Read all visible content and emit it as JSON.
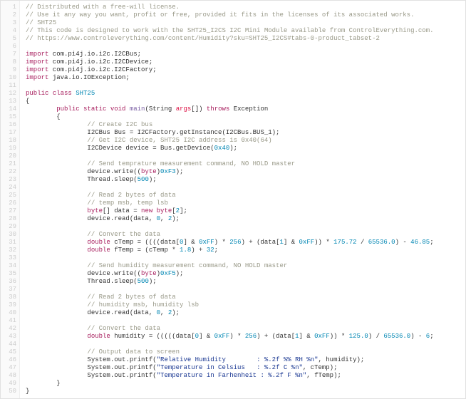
{
  "lines": [
    {
      "num": "1",
      "parts": [
        {
          "cls": "c",
          "t": "// Distributed with a free-will license."
        }
      ]
    },
    {
      "num": "2",
      "parts": [
        {
          "cls": "c",
          "t": "// Use it any way you want, profit or free, provided it fits in the licenses of its associated works."
        }
      ]
    },
    {
      "num": "3",
      "parts": [
        {
          "cls": "c",
          "t": "// SHT25"
        }
      ]
    },
    {
      "num": "4",
      "parts": [
        {
          "cls": "c",
          "t": "// This code is designed to work with the SHT25_I2CS I2C Mini Module available from ControlEverything.com."
        }
      ]
    },
    {
      "num": "5",
      "parts": [
        {
          "cls": "c",
          "t": "// https://www.controleverything.com/content/Humidity?sku=SHT25_I2CS#tabs-0-product_tabset-2"
        }
      ]
    },
    {
      "num": "6",
      "parts": []
    },
    {
      "num": "7",
      "parts": [
        {
          "cls": "kw",
          "t": "import"
        },
        {
          "cls": "id",
          "t": " com.pi4j.io.i2c.I2CBus;"
        }
      ]
    },
    {
      "num": "8",
      "parts": [
        {
          "cls": "kw",
          "t": "import"
        },
        {
          "cls": "id",
          "t": " com.pi4j.io.i2c.I2CDevice;"
        }
      ]
    },
    {
      "num": "9",
      "parts": [
        {
          "cls": "kw",
          "t": "import"
        },
        {
          "cls": "id",
          "t": " com.pi4j.io.i2c.I2CFactory;"
        }
      ]
    },
    {
      "num": "10",
      "parts": [
        {
          "cls": "kw",
          "t": "import"
        },
        {
          "cls": "id",
          "t": " java.io.IOException;"
        }
      ]
    },
    {
      "num": "11",
      "parts": []
    },
    {
      "num": "12",
      "parts": [
        {
          "cls": "kw",
          "t": "public"
        },
        {
          "cls": "id",
          "t": " "
        },
        {
          "cls": "kw",
          "t": "class"
        },
        {
          "cls": "id",
          "t": " "
        },
        {
          "cls": "ty",
          "t": "SHT25"
        }
      ]
    },
    {
      "num": "13",
      "parts": [
        {
          "cls": "id",
          "t": "{"
        }
      ]
    },
    {
      "num": "14",
      "parts": [
        {
          "cls": "id",
          "t": "        "
        },
        {
          "cls": "kw",
          "t": "public"
        },
        {
          "cls": "id",
          "t": " "
        },
        {
          "cls": "kw",
          "t": "static"
        },
        {
          "cls": "id",
          "t": " "
        },
        {
          "cls": "kw",
          "t": "void"
        },
        {
          "cls": "id",
          "t": " "
        },
        {
          "cls": "fn",
          "t": "main"
        },
        {
          "cls": "id",
          "t": "(String "
        },
        {
          "cls": "ar",
          "t": "args"
        },
        {
          "cls": "id",
          "t": "[]) "
        },
        {
          "cls": "kw",
          "t": "throws"
        },
        {
          "cls": "id",
          "t": " Exception"
        }
      ]
    },
    {
      "num": "15",
      "parts": [
        {
          "cls": "id",
          "t": "        {"
        }
      ]
    },
    {
      "num": "16",
      "parts": [
        {
          "cls": "id",
          "t": "                "
        },
        {
          "cls": "c",
          "t": "// Create I2C bus"
        }
      ]
    },
    {
      "num": "17",
      "parts": [
        {
          "cls": "id",
          "t": "                I2CBus Bus = I2CFactory.getInstance(I2CBus.BUS_1);"
        }
      ]
    },
    {
      "num": "18",
      "parts": [
        {
          "cls": "id",
          "t": "                "
        },
        {
          "cls": "c",
          "t": "// Get I2C device, SHT25 I2C address is 0x40(64)"
        }
      ]
    },
    {
      "num": "19",
      "parts": [
        {
          "cls": "id",
          "t": "                I2CDevice device = Bus.getDevice("
        },
        {
          "cls": "nu",
          "t": "0x40"
        },
        {
          "cls": "id",
          "t": ");"
        }
      ]
    },
    {
      "num": "20",
      "parts": []
    },
    {
      "num": "21",
      "parts": [
        {
          "cls": "id",
          "t": "                "
        },
        {
          "cls": "c",
          "t": "// Send temprature measurement command, NO HOLD master"
        }
      ]
    },
    {
      "num": "22",
      "parts": [
        {
          "cls": "id",
          "t": "                device.write(("
        },
        {
          "cls": "kw",
          "t": "byte"
        },
        {
          "cls": "id",
          "t": ")"
        },
        {
          "cls": "nu",
          "t": "0xF3"
        },
        {
          "cls": "id",
          "t": ");"
        }
      ]
    },
    {
      "num": "23",
      "parts": [
        {
          "cls": "id",
          "t": "                Thread.sleep("
        },
        {
          "cls": "nu",
          "t": "500"
        },
        {
          "cls": "id",
          "t": ");"
        }
      ]
    },
    {
      "num": "24",
      "parts": []
    },
    {
      "num": "25",
      "parts": [
        {
          "cls": "id",
          "t": "                "
        },
        {
          "cls": "c",
          "t": "// Read 2 bytes of data"
        }
      ]
    },
    {
      "num": "26",
      "parts": [
        {
          "cls": "id",
          "t": "                "
        },
        {
          "cls": "c",
          "t": "// temp msb, temp lsb"
        }
      ]
    },
    {
      "num": "27",
      "parts": [
        {
          "cls": "id",
          "t": "                "
        },
        {
          "cls": "kw",
          "t": "byte"
        },
        {
          "cls": "id",
          "t": "[] data = "
        },
        {
          "cls": "kw",
          "t": "new"
        },
        {
          "cls": "id",
          "t": " "
        },
        {
          "cls": "kw",
          "t": "byte"
        },
        {
          "cls": "id",
          "t": "["
        },
        {
          "cls": "nu",
          "t": "2"
        },
        {
          "cls": "id",
          "t": "];"
        }
      ]
    },
    {
      "num": "28",
      "parts": [
        {
          "cls": "id",
          "t": "                device.read(data, "
        },
        {
          "cls": "nu",
          "t": "0"
        },
        {
          "cls": "id",
          "t": ", "
        },
        {
          "cls": "nu",
          "t": "2"
        },
        {
          "cls": "id",
          "t": ");"
        }
      ]
    },
    {
      "num": "29",
      "parts": []
    },
    {
      "num": "30",
      "parts": [
        {
          "cls": "id",
          "t": "                "
        },
        {
          "cls": "c",
          "t": "// Convert the data"
        }
      ]
    },
    {
      "num": "31",
      "parts": [
        {
          "cls": "id",
          "t": "                "
        },
        {
          "cls": "kw",
          "t": "double"
        },
        {
          "cls": "id",
          "t": " cTemp = ((((data["
        },
        {
          "cls": "nu",
          "t": "0"
        },
        {
          "cls": "id",
          "t": "] & "
        },
        {
          "cls": "nu",
          "t": "0xFF"
        },
        {
          "cls": "id",
          "t": ") * "
        },
        {
          "cls": "nu",
          "t": "256"
        },
        {
          "cls": "id",
          "t": ") + (data["
        },
        {
          "cls": "nu",
          "t": "1"
        },
        {
          "cls": "id",
          "t": "] & "
        },
        {
          "cls": "nu",
          "t": "0xFF"
        },
        {
          "cls": "id",
          "t": ")) * "
        },
        {
          "cls": "nu",
          "t": "175.72"
        },
        {
          "cls": "id",
          "t": " / "
        },
        {
          "cls": "nu",
          "t": "65536.0"
        },
        {
          "cls": "id",
          "t": ") - "
        },
        {
          "cls": "nu",
          "t": "46.85"
        },
        {
          "cls": "id",
          "t": ";"
        }
      ]
    },
    {
      "num": "32",
      "parts": [
        {
          "cls": "id",
          "t": "                "
        },
        {
          "cls": "kw",
          "t": "double"
        },
        {
          "cls": "id",
          "t": " fTemp = (cTemp * "
        },
        {
          "cls": "nu",
          "t": "1.8"
        },
        {
          "cls": "id",
          "t": ") + "
        },
        {
          "cls": "nu",
          "t": "32"
        },
        {
          "cls": "id",
          "t": ";"
        }
      ]
    },
    {
      "num": "33",
      "parts": []
    },
    {
      "num": "34",
      "parts": [
        {
          "cls": "id",
          "t": "                "
        },
        {
          "cls": "c",
          "t": "// Send humidity measurement command, NO HOLD master"
        }
      ]
    },
    {
      "num": "35",
      "parts": [
        {
          "cls": "id",
          "t": "                device.write(("
        },
        {
          "cls": "kw",
          "t": "byte"
        },
        {
          "cls": "id",
          "t": ")"
        },
        {
          "cls": "nu",
          "t": "0xF5"
        },
        {
          "cls": "id",
          "t": ");"
        }
      ]
    },
    {
      "num": "36",
      "parts": [
        {
          "cls": "id",
          "t": "                Thread.sleep("
        },
        {
          "cls": "nu",
          "t": "500"
        },
        {
          "cls": "id",
          "t": ");"
        }
      ]
    },
    {
      "num": "37",
      "parts": []
    },
    {
      "num": "38",
      "parts": [
        {
          "cls": "id",
          "t": "                "
        },
        {
          "cls": "c",
          "t": "// Read 2 bytes of data"
        }
      ]
    },
    {
      "num": "39",
      "parts": [
        {
          "cls": "id",
          "t": "                "
        },
        {
          "cls": "c",
          "t": "// humidity msb, humidity lsb"
        }
      ]
    },
    {
      "num": "40",
      "parts": [
        {
          "cls": "id",
          "t": "                device.read(data, "
        },
        {
          "cls": "nu",
          "t": "0"
        },
        {
          "cls": "id",
          "t": ", "
        },
        {
          "cls": "nu",
          "t": "2"
        },
        {
          "cls": "id",
          "t": ");"
        }
      ]
    },
    {
      "num": "41",
      "parts": []
    },
    {
      "num": "42",
      "parts": [
        {
          "cls": "id",
          "t": "                "
        },
        {
          "cls": "c",
          "t": "// Convert the data"
        }
      ]
    },
    {
      "num": "43",
      "parts": [
        {
          "cls": "id",
          "t": "                "
        },
        {
          "cls": "kw",
          "t": "double"
        },
        {
          "cls": "id",
          "t": " humidity = (((((data["
        },
        {
          "cls": "nu",
          "t": "0"
        },
        {
          "cls": "id",
          "t": "] & "
        },
        {
          "cls": "nu",
          "t": "0xFF"
        },
        {
          "cls": "id",
          "t": ") * "
        },
        {
          "cls": "nu",
          "t": "256"
        },
        {
          "cls": "id",
          "t": ") + (data["
        },
        {
          "cls": "nu",
          "t": "1"
        },
        {
          "cls": "id",
          "t": "] & "
        },
        {
          "cls": "nu",
          "t": "0xFF"
        },
        {
          "cls": "id",
          "t": ")) * "
        },
        {
          "cls": "nu",
          "t": "125.0"
        },
        {
          "cls": "id",
          "t": ") / "
        },
        {
          "cls": "nu",
          "t": "65536.0"
        },
        {
          "cls": "id",
          "t": ") - "
        },
        {
          "cls": "nu",
          "t": "6"
        },
        {
          "cls": "id",
          "t": ";"
        }
      ]
    },
    {
      "num": "44",
      "parts": []
    },
    {
      "num": "45",
      "parts": [
        {
          "cls": "id",
          "t": "                "
        },
        {
          "cls": "c",
          "t": "// Output data to screen"
        }
      ]
    },
    {
      "num": "46",
      "parts": [
        {
          "cls": "id",
          "t": "                System.out.printf("
        },
        {
          "cls": "st",
          "t": "\"Relative Humidity        : %.2f %% RH %n\""
        },
        {
          "cls": "id",
          "t": ", humidity);"
        }
      ]
    },
    {
      "num": "47",
      "parts": [
        {
          "cls": "id",
          "t": "                System.out.printf("
        },
        {
          "cls": "st",
          "t": "\"Temperature in Celsius   : %.2f C %n\""
        },
        {
          "cls": "id",
          "t": ", cTemp);"
        }
      ]
    },
    {
      "num": "48",
      "parts": [
        {
          "cls": "id",
          "t": "                System.out.printf("
        },
        {
          "cls": "st",
          "t": "\"Temperature in Farhenheit : %.2f F %n\""
        },
        {
          "cls": "id",
          "t": ", fTemp);"
        }
      ]
    },
    {
      "num": "49",
      "parts": [
        {
          "cls": "id",
          "t": "        }"
        }
      ]
    },
    {
      "num": "50",
      "parts": [
        {
          "cls": "id",
          "t": "}"
        }
      ]
    }
  ]
}
